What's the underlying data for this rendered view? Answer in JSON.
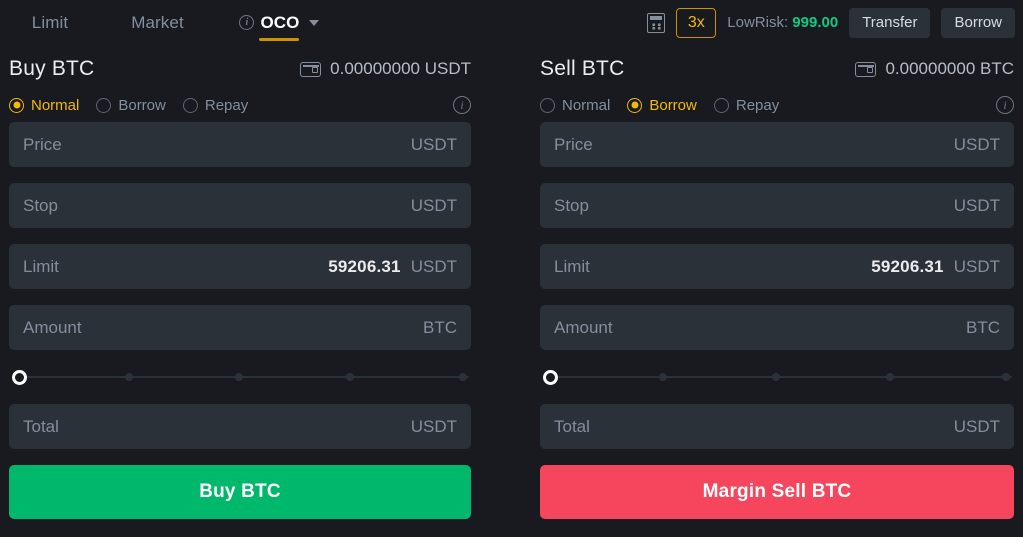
{
  "order_type_tabs": [
    {
      "label": "Limit",
      "active": false,
      "has_info": false,
      "has_chevron": false
    },
    {
      "label": "Market",
      "active": false,
      "has_info": false,
      "has_chevron": false
    },
    {
      "label": "OCO",
      "active": true,
      "has_info": true,
      "has_chevron": true
    }
  ],
  "toolbar": {
    "calculator_icon": "calculator-icon",
    "leverage": "3x",
    "risk_label": "LowRisk:",
    "risk_value": "999.00",
    "transfer_label": "Transfer",
    "borrow_label": "Borrow"
  },
  "colors": {
    "accent_gold": "#f0b90b",
    "buy_green": "#00b86b",
    "sell_red": "#f6465d",
    "risk_green": "#0ecb81",
    "field_bg": "#2b3139",
    "page_bg": "#181a20"
  },
  "buy_panel": {
    "title": "Buy BTC",
    "wallet_icon": "wallet-icon",
    "balance": "0.00000000 USDT",
    "modes": [
      {
        "label": "Normal",
        "selected": true
      },
      {
        "label": "Borrow",
        "selected": false
      },
      {
        "label": "Repay",
        "selected": false
      }
    ],
    "info_icon": "info-icon",
    "fields": [
      {
        "label": "Price",
        "value": "",
        "unit": "USDT"
      },
      {
        "label": "Stop",
        "value": "",
        "unit": "USDT"
      },
      {
        "label": "Limit",
        "value": "59206.31",
        "unit": "USDT"
      },
      {
        "label": "Amount",
        "value": "",
        "unit": "BTC"
      }
    ],
    "slider": {
      "percent": 0,
      "ticks": [
        0,
        25,
        50,
        75,
        100
      ]
    },
    "total": {
      "label": "Total",
      "value": "",
      "unit": "USDT"
    },
    "submit_label": "Buy BTC"
  },
  "sell_panel": {
    "title": "Sell BTC",
    "wallet_icon": "wallet-icon",
    "balance": "0.00000000 BTC",
    "modes": [
      {
        "label": "Normal",
        "selected": false
      },
      {
        "label": "Borrow",
        "selected": true
      },
      {
        "label": "Repay",
        "selected": false
      }
    ],
    "info_icon": "info-icon",
    "fields": [
      {
        "label": "Price",
        "value": "",
        "unit": "USDT"
      },
      {
        "label": "Stop",
        "value": "",
        "unit": "USDT"
      },
      {
        "label": "Limit",
        "value": "59206.31",
        "unit": "USDT"
      },
      {
        "label": "Amount",
        "value": "",
        "unit": "BTC"
      }
    ],
    "slider": {
      "percent": 0,
      "ticks": [
        0,
        25,
        50,
        75,
        100
      ]
    },
    "total": {
      "label": "Total",
      "value": "",
      "unit": "USDT"
    },
    "submit_label": "Margin Sell BTC"
  }
}
